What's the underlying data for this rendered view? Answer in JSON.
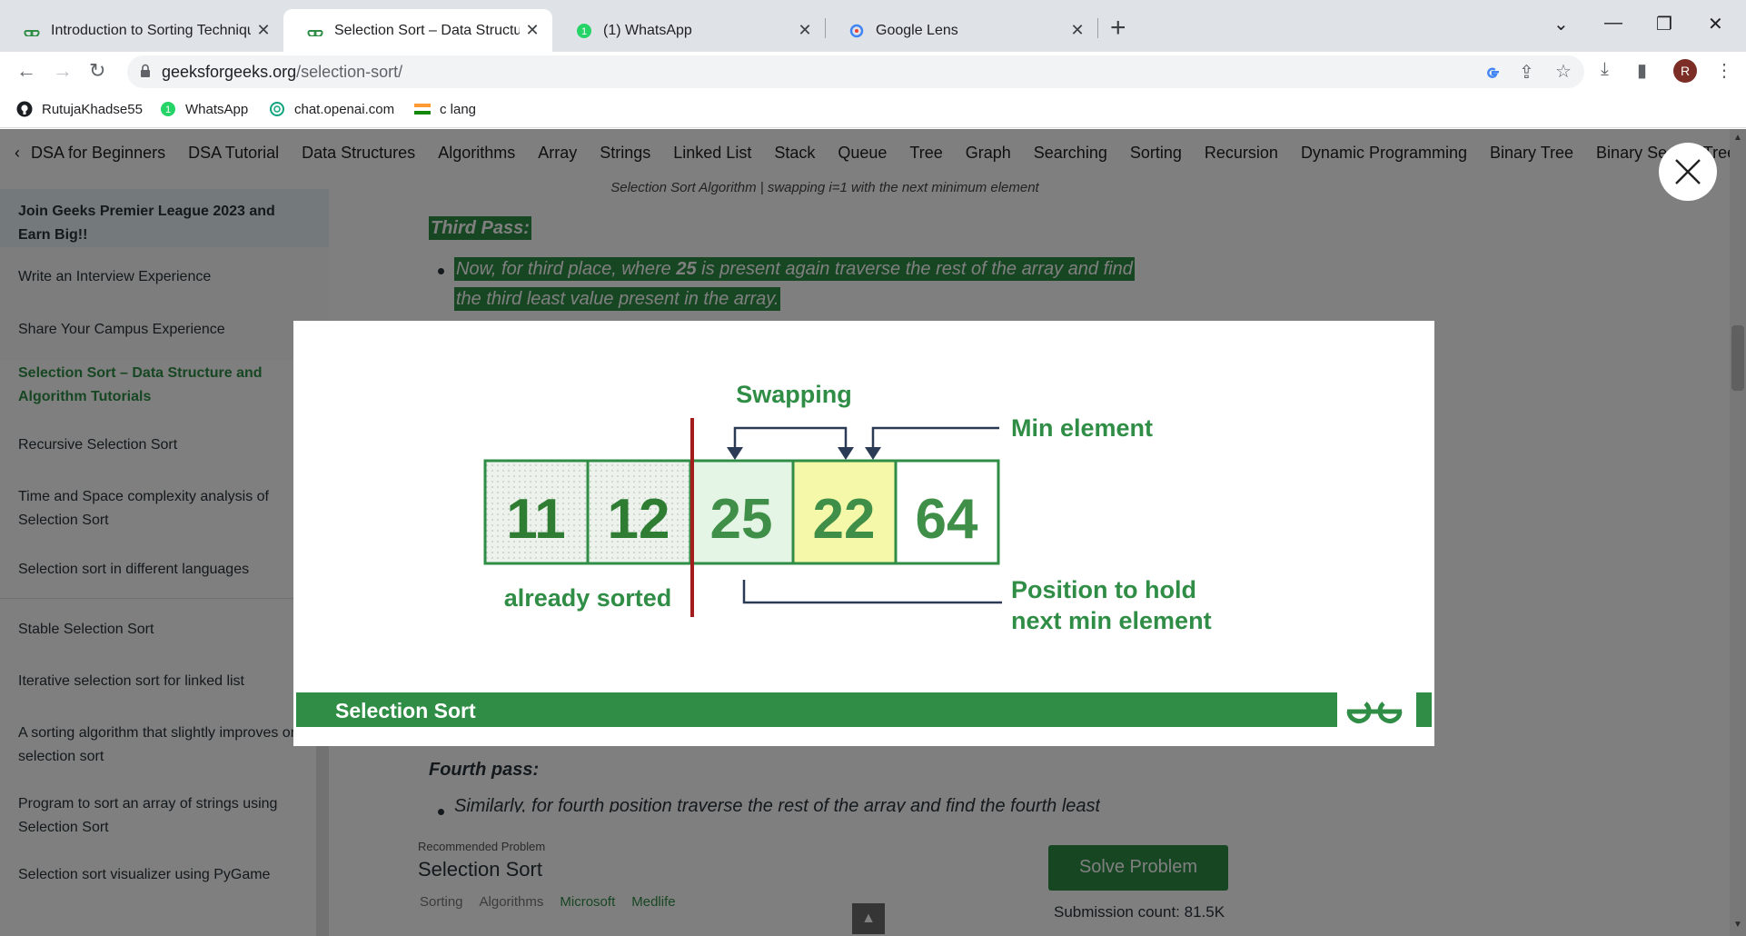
{
  "browser": {
    "tabs": [
      {
        "title": "Introduction to Sorting Techniqu",
        "favicon": "gfg-icon",
        "active": false
      },
      {
        "title": "Selection Sort – Data Structure a",
        "favicon": "gfg-icon",
        "active": true
      },
      {
        "title": "(1) WhatsApp",
        "favicon": "whatsapp-icon",
        "active": false
      },
      {
        "title": "Google Lens",
        "favicon": "google-lens-icon",
        "active": false
      }
    ],
    "url_domain": "geeksforgeeks.org",
    "url_path": "/selection-sort/",
    "profile_initial": "R",
    "bookmarks": [
      {
        "label": "RutujaKhadse55",
        "icon": "github-icon"
      },
      {
        "label": "WhatsApp",
        "icon": "whatsapp-icon"
      },
      {
        "label": "chat.openai.com",
        "icon": "openai-icon"
      },
      {
        "label": "c lang",
        "icon": "flag-icon"
      }
    ]
  },
  "topnav": {
    "items": [
      "DSA for Beginners",
      "DSA Tutorial",
      "Data Structures",
      "Algorithms",
      "Array",
      "Strings",
      "Linked List",
      "Stack",
      "Queue",
      "Tree",
      "Graph",
      "Searching",
      "Sorting",
      "Recursion",
      "Dynamic Programming",
      "Binary Tree",
      "Binary Search Tree"
    ]
  },
  "sidebar": {
    "items": [
      {
        "label": "Join Geeks Premier League 2023 and Earn Big!!"
      },
      {
        "label": "Write an Interview Experience"
      },
      {
        "label": "Share Your Campus Experience"
      },
      {
        "label": "Selection Sort – Data Structure and Algorithm Tutorials"
      },
      {
        "label": "Recursive Selection Sort"
      },
      {
        "label": "Time and Space complexity analysis of Selection Sort"
      },
      {
        "label": "Selection sort in different languages"
      },
      {
        "label": "Stable Selection Sort"
      },
      {
        "label": "Iterative selection sort for linked list"
      },
      {
        "label": "A sorting algorithm that slightly improves on selection sort"
      },
      {
        "label": "Program to sort an array of strings using Selection Sort"
      },
      {
        "label": "Selection sort visualizer using PyGame"
      }
    ]
  },
  "article": {
    "caption": "Selection Sort Algorithm | swapping i=1 with the next minimum element",
    "third_pass_heading": "Third Pass:",
    "third_pass_line1_pre": "Now, for third place, where ",
    "third_pass_line1_bold": "25",
    "third_pass_line1_post": " is present again traverse the rest of the array and find",
    "third_pass_line2": "the third least value present in the array.",
    "fourth_pass_heading": "Fourth pass:",
    "fourth_pass_line": "Similarly, for fourth position traverse the rest of the array and find the fourth least"
  },
  "recommended": {
    "label": "Recommended Problem",
    "title": "Selection Sort",
    "tags": [
      "Sorting",
      "Algorithms",
      "Microsoft",
      "Medlife"
    ],
    "solve_button": "Solve Problem",
    "submission_count": "Submission count: 81.5K"
  },
  "lightbox": {
    "diagram": {
      "array": [
        "11",
        "12",
        "25",
        "22",
        "64"
      ],
      "swapping_label": "Swapping",
      "min_element_label": "Min element",
      "already_sorted_label": "already sorted",
      "position_label_line1": "Position to hold",
      "position_label_line2": "next min element"
    },
    "footer_title": "Selection Sort",
    "colors": {
      "green": "#2f8d46",
      "dark_green": "#2e7d32",
      "arrow_navy": "#2b3a55",
      "divider_red": "#a31d1d",
      "sorted_fill": "#e6ede6",
      "cell_25_fill": "#e5f5e5",
      "cell_22_fill": "#f6f8a9"
    }
  }
}
